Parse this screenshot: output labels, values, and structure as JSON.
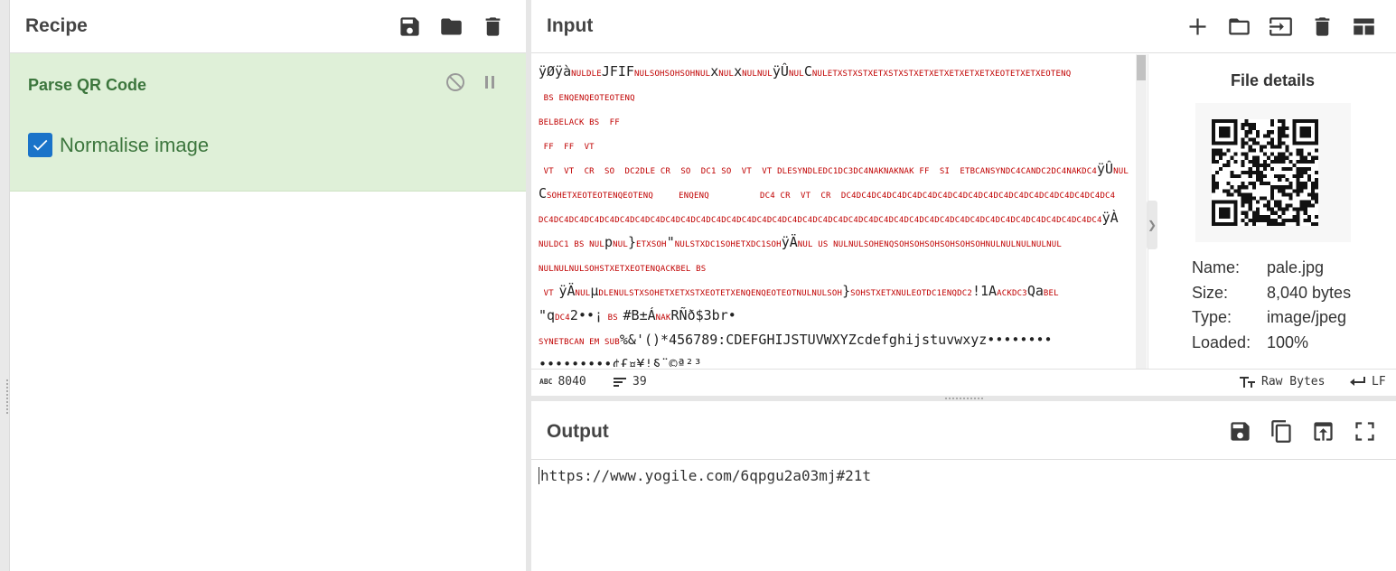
{
  "recipe": {
    "title": "Recipe",
    "header_icons": [
      "save-icon",
      "folder-icon",
      "trash-icon"
    ]
  },
  "operation": {
    "name": "Parse QR Code",
    "option_label": "Normalise image",
    "option_checked": true,
    "controls": [
      "disable-icon",
      "pause-icon"
    ]
  },
  "input": {
    "title": "Input",
    "header_icons": [
      "plus-icon",
      "folder-icon",
      "input-file-icon",
      "trash-icon",
      "layout-icon"
    ],
    "lines": [
      [
        [
          "hi",
          "ÿØÿà"
        ],
        [
          "c",
          "NULDLE"
        ],
        [
          "hi",
          "JFIF"
        ],
        [
          "c",
          "NULSOHSOHSOHNUL"
        ],
        [
          "hi",
          "x"
        ],
        [
          "c",
          "NUL"
        ],
        [
          "hi",
          "x"
        ],
        [
          "c",
          "NULNUL"
        ],
        [
          "hi",
          "ÿÛ"
        ],
        [
          "c",
          "NUL"
        ],
        [
          "hi",
          "C"
        ],
        [
          "c",
          "NULETXSTXSTXETXSTXSTXETXETXETXETXETXEOTETXETXEOTENQ"
        ]
      ],
      [
        [
          "c",
          " BS ENQENQEOTEOTENQ"
        ]
      ],
      [
        [
          "c",
          "BELBELACK BS  FF"
        ]
      ],
      [
        [
          "c",
          " FF  FF  VT"
        ]
      ],
      [
        [
          "c",
          " VT  VT  CR  SO  DC2DLE CR  SO  DC1 SO  VT  VT DLESYNDLEDC1DC3DC4NAKNAKNAK FF  SI  ETBCANSYNDC4CANDC2DC4NAKDC4"
        ],
        [
          "hi",
          "ÿÛ"
        ],
        [
          "c",
          "NUL"
        ]
      ],
      [
        [
          "hi",
          "C"
        ],
        [
          "c",
          "SOHETXEOTEOTENQEOTENQ     ENQENQ          DC4 CR  VT  CR  DC4DC4DC4DC4DC4DC4DC4DC4DC4DC4DC4DC4DC4DC4DC4DC4DC4DC4"
        ]
      ],
      [
        [
          "c",
          "DC4DC4DC4DC4DC4DC4DC4DC4DC4DC4DC4DC4DC4DC4DC4DC4DC4DC4DC4DC4DC4DC4DC4DC4DC4DC4DC4DC4DC4DC4DC4DC4DC4DC4DC4DC4DC4"
        ],
        [
          "hi",
          "ÿÀ"
        ]
      ],
      [
        [
          "c",
          "NULDC1 BS NUL"
        ],
        [
          "hi",
          "p"
        ],
        [
          "c",
          "NUL"
        ],
        [
          "hi",
          "}"
        ],
        [
          "c",
          "ETXSOH"
        ],
        [
          "hi",
          "\""
        ],
        [
          "c",
          "NULSTXDC1SOHETXDC1SOH"
        ],
        [
          "hi",
          "ÿÄ"
        ],
        [
          "c",
          "NUL US NULNULSOHENQSOHSOHSOHSOHSOHSOHNULNULNULNULNUL"
        ]
      ],
      [
        [
          "c",
          "NULNULNULSOHSTXETXEOTENQACKBEL BS"
        ]
      ],
      [
        [
          "c",
          " VT "
        ],
        [
          "hi",
          "ÿÄ"
        ],
        [
          "c",
          "NUL"
        ],
        [
          "hi",
          "µ"
        ],
        [
          "c",
          "DLENULSTXSOHETXETXSTXEOTETXENQENQEOTEOTNULNULSOH"
        ],
        [
          "hi",
          "}"
        ],
        [
          "c",
          "SOHSTXETXNULEOTDC1ENQDC2"
        ],
        [
          "hi",
          "!1A"
        ],
        [
          "c",
          "ACKDC3"
        ],
        [
          "hi",
          "Qa"
        ],
        [
          "c",
          "BEL"
        ]
      ],
      [
        [
          "hi",
          "\"q"
        ],
        [
          "c",
          "DC4"
        ],
        [
          "hi",
          "2••¡"
        ],
        [
          "c",
          " BS "
        ],
        [
          "hi",
          "#B±Á"
        ],
        [
          "c",
          "NAK"
        ],
        [
          "hi",
          "RÑð$3br•"
        ]
      ],
      [
        [
          "c",
          "SYNETBCAN EM SUB"
        ],
        [
          "hi",
          "%&'()*456789:CDEFGHIJSTUVWXYZcdefghijstuvwxyz••••••••"
        ]
      ],
      [
        [
          "hi",
          "•••••••••¢£¤¥¦§¨©ª²³"
        ]
      ]
    ],
    "status": {
      "chars_label": "ABC",
      "chars": "8040",
      "lines": "39",
      "encoding": "Raw Bytes",
      "eol": "LF"
    }
  },
  "file_details": {
    "title": "File details",
    "rows": [
      {
        "label": "Name:",
        "value": "pale.jpg"
      },
      {
        "label": "Size:",
        "value": "8,040 bytes"
      },
      {
        "label": "Type:",
        "value": "image/jpeg"
      },
      {
        "label": "Loaded:",
        "value": "100%"
      }
    ]
  },
  "output": {
    "title": "Output",
    "header_icons": [
      "save-icon",
      "copy-icon",
      "replace-input-icon",
      "maximise-icon"
    ],
    "text": "https://www.yogile.com/6qpgu2a03mj#21t"
  },
  "colors": {
    "op_background": "#dff0d8",
    "op_text": "#3c763d",
    "checkbox": "#1a73c9",
    "control_chars": "#c00000"
  }
}
